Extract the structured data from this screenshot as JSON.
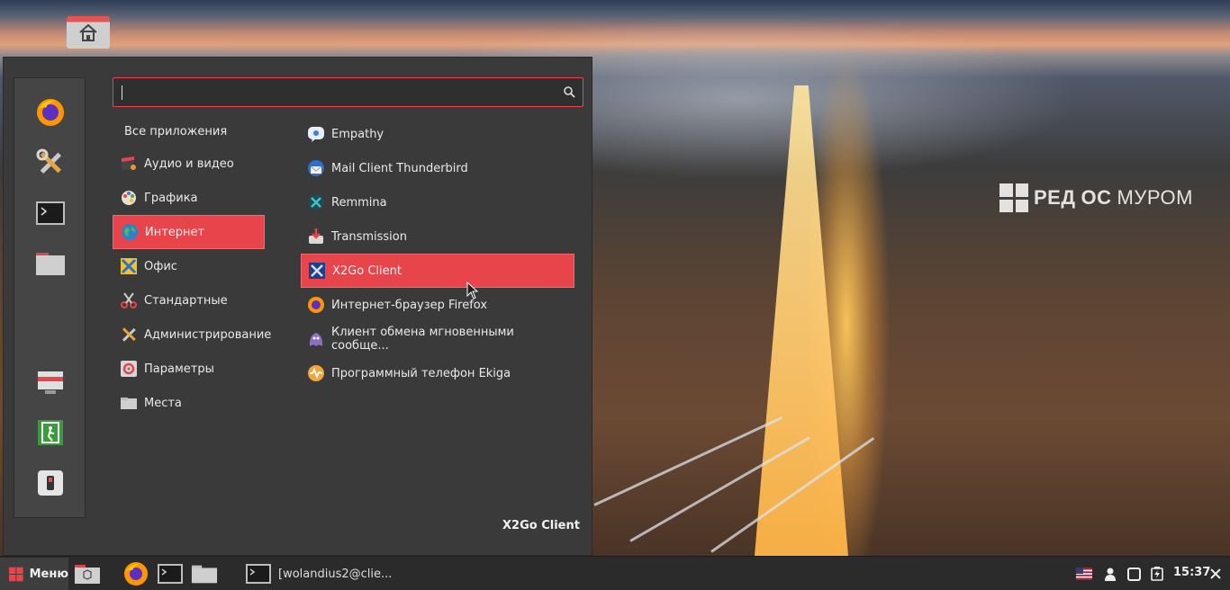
{
  "search": {
    "value": "",
    "placeholder": ""
  },
  "categories": [
    {
      "label": "Все приложения",
      "icon": "none"
    },
    {
      "label": "Аудио и видео",
      "icon": "multimedia-icon"
    },
    {
      "label": "Графика",
      "icon": "graphics-icon"
    },
    {
      "label": "Интернет",
      "icon": "internet-globe-icon",
      "selected": true
    },
    {
      "label": "Офис",
      "icon": "office-icon"
    },
    {
      "label": "Стандартные",
      "icon": "accessories-icon"
    },
    {
      "label": "Администрирование",
      "icon": "administration-icon"
    },
    {
      "label": "Параметры",
      "icon": "preferences-icon"
    },
    {
      "label": "Места",
      "icon": "places-folder-icon"
    }
  ],
  "apps": [
    {
      "label": "Empathy",
      "icon": "empathy-icon"
    },
    {
      "label": "Mail Client Thunderbird",
      "icon": "thunderbird-icon"
    },
    {
      "label": "Remmina",
      "icon": "remmina-icon"
    },
    {
      "label": "Transmission",
      "icon": "transmission-icon"
    },
    {
      "label": "X2Go Client",
      "icon": "x2go-icon",
      "selected": true
    },
    {
      "label": "Интернет-браузер Firefox",
      "icon": "firefox-icon"
    },
    {
      "label": "Клиент обмена мгновенными сообще...",
      "icon": "pidgin-icon"
    },
    {
      "label": "Программный телефон Ekiga",
      "icon": "ekiga-icon"
    }
  ],
  "favorites": [
    "firefox-icon",
    "settings-tools-icon",
    "terminal-icon",
    "files-folder-icon",
    "lock-screen-icon",
    "logout-icon",
    "shutdown-icon"
  ],
  "selected_app_tooltip": "X2Go Client",
  "wallpaper_logo": {
    "prefix": "РЕД",
    "mid": "ОС",
    "suffix": "МУРОМ"
  },
  "taskbar": {
    "menu_label": "Меню",
    "window_title": "[wolandius2@clie...",
    "clock": "15:37"
  },
  "colors": {
    "accent": "#e7444c",
    "panel": "#3a3a3a",
    "taskbar": "#2b2b2b"
  }
}
